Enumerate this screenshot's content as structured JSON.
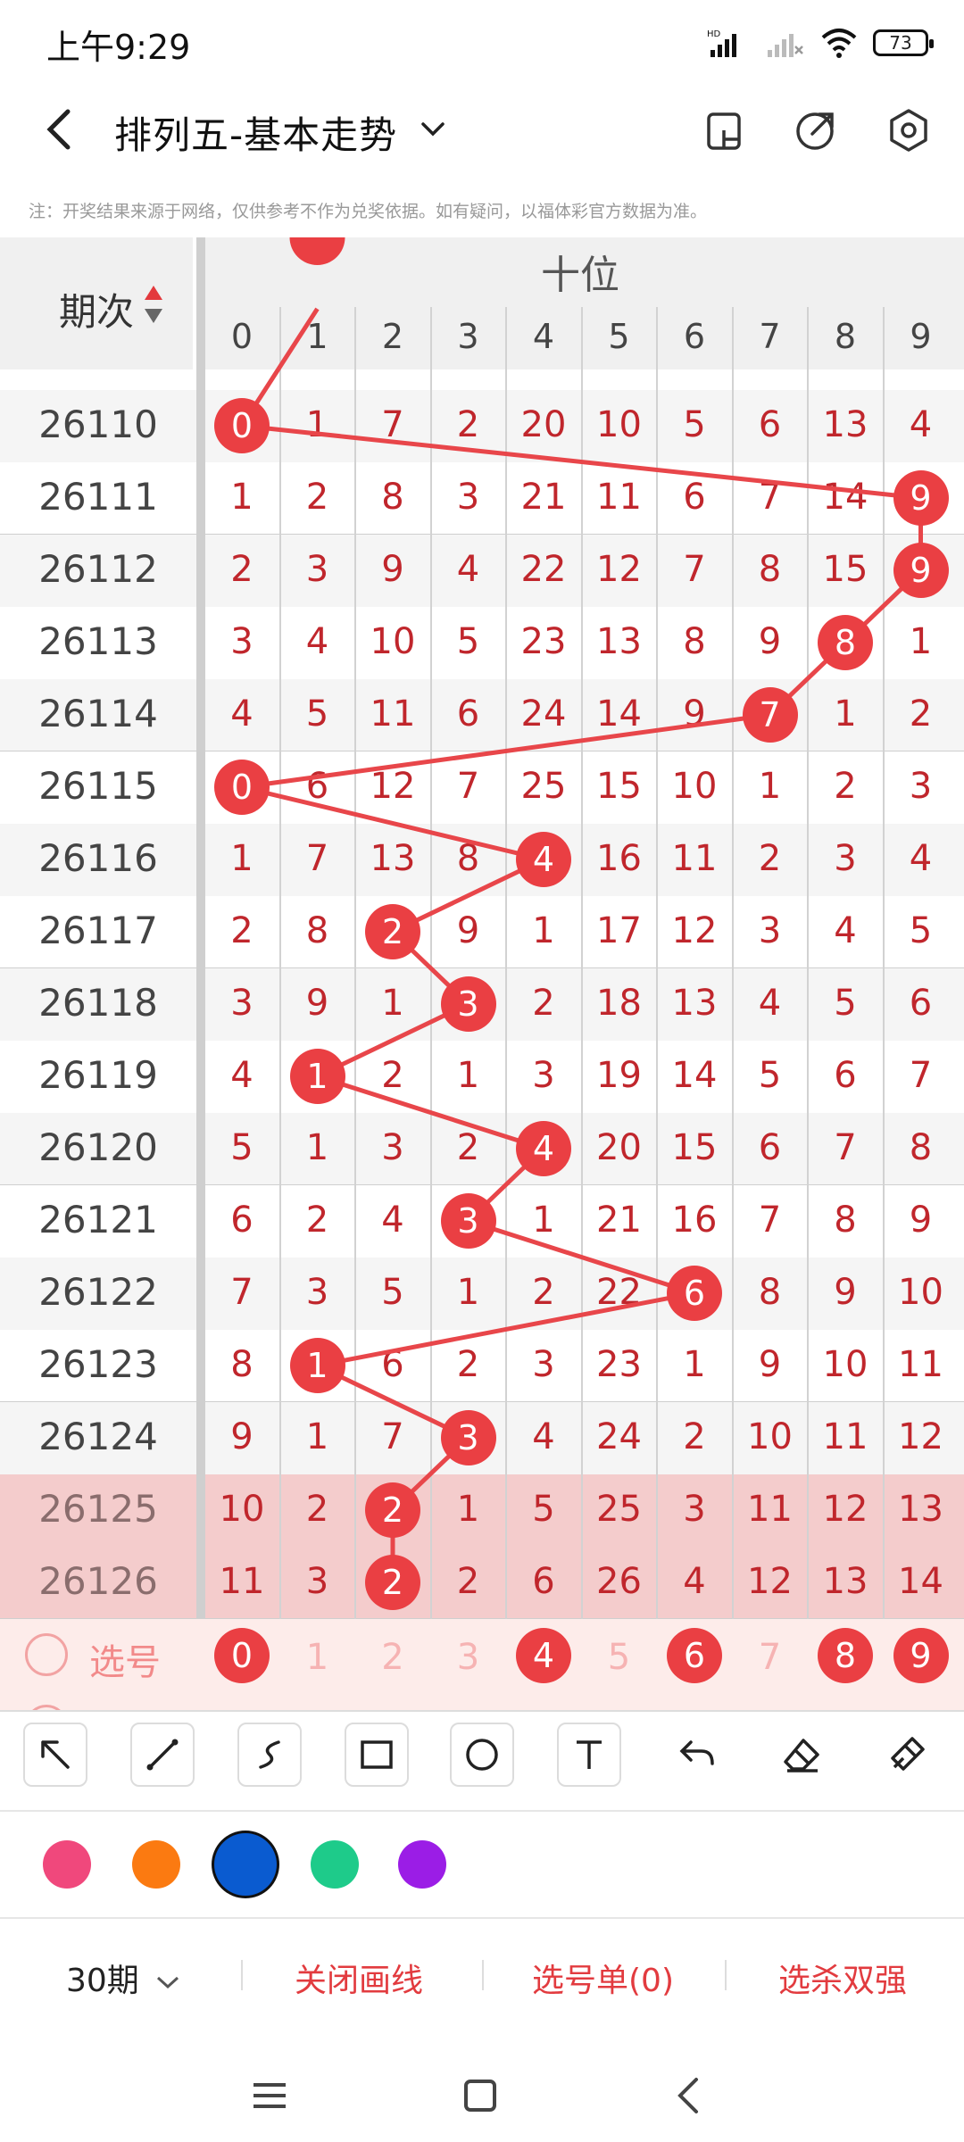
{
  "status": {
    "time": "上午9:29",
    "battery": "73"
  },
  "header": {
    "title": "排列五-基本走势"
  },
  "disclaimer": "注：开奖结果来源于网络，仅供参考不作为兑奖依据。如有疑问，以福体彩官方数据为准。",
  "table": {
    "period_header": "期次",
    "section_header": "十位",
    "digits": [
      "0",
      "1",
      "2",
      "3",
      "4",
      "5",
      "6",
      "7",
      "8",
      "9"
    ],
    "rows": [
      {
        "period": "26110",
        "values": [
          "0",
          "1",
          "7",
          "2",
          "20",
          "10",
          "5",
          "6",
          "13",
          "4"
        ],
        "hit": 0
      },
      {
        "period": "26111",
        "values": [
          "1",
          "2",
          "8",
          "3",
          "21",
          "11",
          "6",
          "7",
          "14",
          "9"
        ],
        "hit": 9
      },
      {
        "period": "26112",
        "values": [
          "2",
          "3",
          "9",
          "4",
          "22",
          "12",
          "7",
          "8",
          "15",
          "9"
        ],
        "hit": 9
      },
      {
        "period": "26113",
        "values": [
          "3",
          "4",
          "10",
          "5",
          "23",
          "13",
          "8",
          "9",
          "8",
          "1"
        ],
        "hit": 8
      },
      {
        "period": "26114",
        "values": [
          "4",
          "5",
          "11",
          "6",
          "24",
          "14",
          "9",
          "7",
          "1",
          "2"
        ],
        "hit": 7
      },
      {
        "period": "26115",
        "values": [
          "0",
          "6",
          "12",
          "7",
          "25",
          "15",
          "10",
          "1",
          "2",
          "3"
        ],
        "hit": 0
      },
      {
        "period": "26116",
        "values": [
          "1",
          "7",
          "13",
          "8",
          "4",
          "16",
          "11",
          "2",
          "3",
          "4"
        ],
        "hit": 4
      },
      {
        "period": "26117",
        "values": [
          "2",
          "8",
          "2",
          "9",
          "1",
          "17",
          "12",
          "3",
          "4",
          "5"
        ],
        "hit": 2
      },
      {
        "period": "26118",
        "values": [
          "3",
          "9",
          "1",
          "3",
          "2",
          "18",
          "13",
          "4",
          "5",
          "6"
        ],
        "hit": 3
      },
      {
        "period": "26119",
        "values": [
          "4",
          "1",
          "2",
          "1",
          "3",
          "19",
          "14",
          "5",
          "6",
          "7"
        ],
        "hit": 1
      },
      {
        "period": "26120",
        "values": [
          "5",
          "1",
          "3",
          "2",
          "4",
          "20",
          "15",
          "6",
          "7",
          "8"
        ],
        "hit": 4
      },
      {
        "period": "26121",
        "values": [
          "6",
          "2",
          "4",
          "3",
          "1",
          "21",
          "16",
          "7",
          "8",
          "9"
        ],
        "hit": 3
      },
      {
        "period": "26122",
        "values": [
          "7",
          "3",
          "5",
          "1",
          "2",
          "22",
          "6",
          "8",
          "9",
          "10"
        ],
        "hit": 6
      },
      {
        "period": "26123",
        "values": [
          "8",
          "1",
          "6",
          "2",
          "3",
          "23",
          "1",
          "9",
          "10",
          "11"
        ],
        "hit": 1
      },
      {
        "period": "26124",
        "values": [
          "9",
          "1",
          "7",
          "3",
          "4",
          "24",
          "2",
          "10",
          "11",
          "12"
        ],
        "hit": 3
      },
      {
        "period": "26125",
        "values": [
          "10",
          "2",
          "2",
          "1",
          "5",
          "25",
          "3",
          "11",
          "12",
          "13"
        ],
        "hit": 2
      },
      {
        "period": "26126",
        "values": [
          "11",
          "3",
          "2",
          "2",
          "6",
          "26",
          "4",
          "12",
          "13",
          "14"
        ],
        "hit": 2
      }
    ],
    "select_row": {
      "label": "选号",
      "numbers": [
        "0",
        "1",
        "2",
        "3",
        "4",
        "5",
        "6",
        "7",
        "8",
        "9"
      ],
      "selected": [
        0,
        4,
        6,
        8,
        9
      ]
    }
  },
  "toolbar": {
    "tools": [
      "arrow-icon",
      "line-icon",
      "curve-icon",
      "rectangle-icon",
      "circle-icon",
      "text-icon",
      "undo-icon",
      "eraser-icon",
      "clear-icon"
    ],
    "colors": [
      "#f0487c",
      "#fb7a11",
      "#0a5bd0",
      "#1ecb8a",
      "#9b1de6"
    ],
    "selected_color": "#0a5bd0"
  },
  "bottom_bar": {
    "period_select": "30期",
    "close_lines": "关闭画线",
    "selection_list": "选号单(0)",
    "filter": "选杀双强"
  }
}
